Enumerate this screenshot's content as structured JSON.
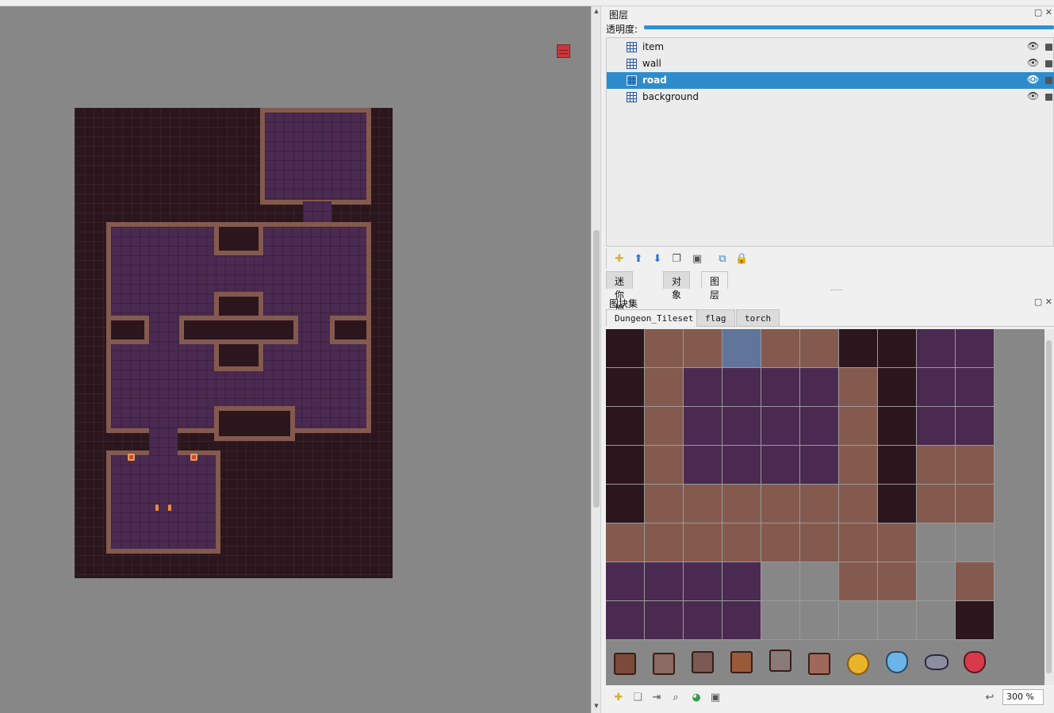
{
  "layers_panel": {
    "title": "图层",
    "opacity_label": "透明度:",
    "layers": [
      {
        "name": "item",
        "selected": false
      },
      {
        "name": "wall",
        "selected": false
      },
      {
        "name": "road",
        "selected": true
      },
      {
        "name": "background",
        "selected": false
      }
    ]
  },
  "bottom_tabs": [
    "迷你地图",
    "对象",
    "图层"
  ],
  "tileset_panel": {
    "title": "图块集",
    "tabs": [
      "Dungeon_Tileset",
      "flag",
      "torch"
    ],
    "zoom": "300 %"
  },
  "icons": {
    "eye": "eye-icon",
    "lock": "lock-icon",
    "new_layer": "new-layer-icon",
    "move_up": "arrow-up-icon",
    "move_down": "arrow-down-icon",
    "duplicate": "duplicate-icon",
    "delete": "trash-icon",
    "undo": "undo-icon"
  },
  "colors": {
    "selection": "#2f8ccc",
    "map_background": "#2b161d",
    "floor": "#4a2a50",
    "wall": "#845a4e",
    "canvas_grey": "#878787"
  }
}
